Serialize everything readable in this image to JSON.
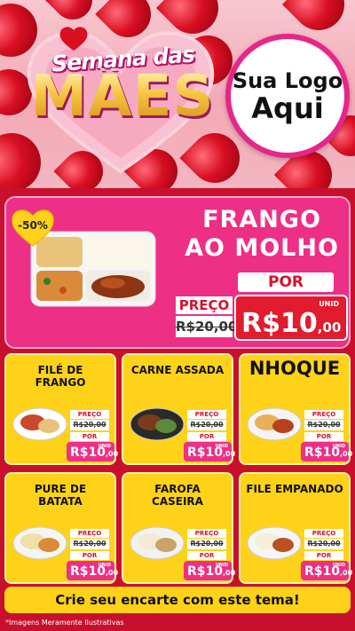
{
  "header": {
    "title_small": "Semana das",
    "title_big": "MÃES",
    "logo_line1": "Sua Logo",
    "logo_line2": "Aqui"
  },
  "promo": {
    "discount": "-50%",
    "name_line1": "FRANGO",
    "name_line2": "AO MOLHO",
    "preco_label": "PREÇO",
    "old_price": "R$20,00",
    "por_label": "POR",
    "unid_label": "UNID",
    "new_price_main": "R$10",
    "new_price_cents": ",00"
  },
  "cards": [
    {
      "title": "FILÉ DE FRANGO",
      "preco_label": "PREÇO",
      "old_price": "R$20,00",
      "por_label": "POR",
      "unid_label": "UNID",
      "price_main": "R$10",
      "price_cents": ",00"
    },
    {
      "title": "CARNE ASSADA",
      "preco_label": "PREÇO",
      "old_price": "R$20,00",
      "por_label": "POR",
      "unid_label": "UNID",
      "price_main": "R$10",
      "price_cents": ",00"
    },
    {
      "title": "NHOQUE",
      "preco_label": "PREÇO",
      "old_price": "R$20,00",
      "por_label": "POR",
      "unid_label": "UNID",
      "price_main": "R$10",
      "price_cents": ",00"
    },
    {
      "title": "PURE DE BATATA",
      "preco_label": "PREÇO",
      "old_price": "R$20,00",
      "por_label": "POR",
      "unid_label": "UNID",
      "price_main": "R$10",
      "price_cents": ",00"
    },
    {
      "title": "FAROFA CASEIRA",
      "preco_label": "PREÇO",
      "old_price": "R$20,00",
      "por_label": "POR",
      "unid_label": "UNID",
      "price_main": "R$10",
      "price_cents": ",00"
    },
    {
      "title": "FILE EMPANADO",
      "preco_label": "PREÇO",
      "old_price": "R$20,00",
      "por_label": "POR",
      "unid_label": "UNID",
      "price_main": "R$10",
      "price_cents": ",00"
    }
  ],
  "cta": "Crie seu encarte com este tema!",
  "disclaimer": "*Imagens Meramente Ilustrativas",
  "colors": {
    "background": "#c8102e",
    "promo": "#ee2f86",
    "card": "#ffd21a",
    "price_red": "#e21b2e"
  }
}
